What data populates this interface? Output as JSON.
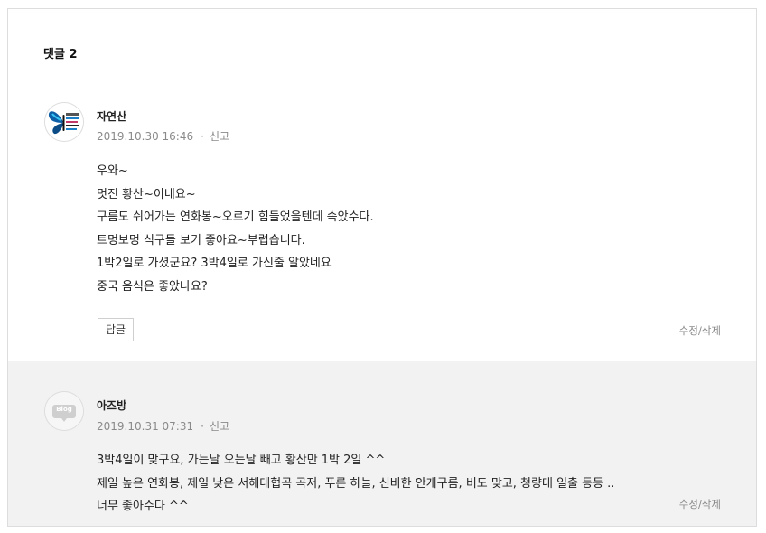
{
  "comments_section": {
    "title": "댓글 2",
    "comments": [
      {
        "author": "자연산",
        "date": "2019.10.30 16:46",
        "report_label": "신고",
        "lines": [
          "우와~",
          "멋진 황산~이네요~",
          "구름도 쉬어가는 연화봉~오르기 힘들었을텐데 속았수다.",
          "트멍보멍 식구들 보기 좋아요~부럽습니다.",
          "1박2일로 가셨군요? 3박4일로 가신줄 알았네요",
          "중국 음식은 좋았나요?"
        ],
        "reply_label": "답글",
        "edit_delete_label": "수정/삭제",
        "avatar_icon": "butterfly-icon"
      },
      {
        "author": "아즈방",
        "date": "2019.10.31 07:31",
        "report_label": "신고",
        "lines": [
          "3박4일이 맞구요, 가는날 오는날 빼고 황산만 1박 2일 ^^",
          "제일 높은 연화봉, 제일 낮은 서해대협곡 곡저, 푸른 하늘, 신비한 안개구름, 비도 맞고,  청량대 일출 등등 ..",
          "너무 좋아수다 ^^"
        ],
        "edit_delete_label": "수정/삭제",
        "avatar_icon": "blog-icon",
        "avatar_text": "Blog"
      }
    ]
  }
}
